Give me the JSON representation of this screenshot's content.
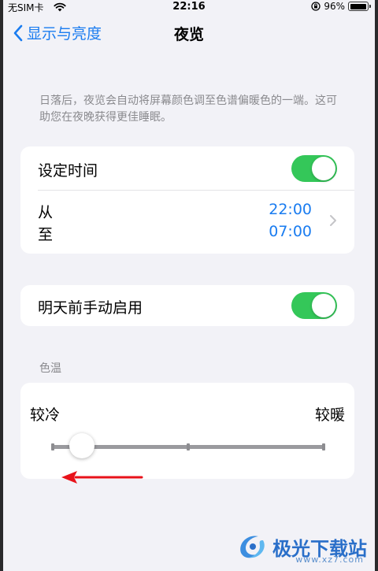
{
  "status_bar": {
    "carrier": "无SIM卡",
    "time": "22:16",
    "battery": "96%",
    "battery_level": 0.96,
    "icons": [
      "wifi-icon",
      "rotation-lock-icon",
      "battery-icon"
    ]
  },
  "nav": {
    "back_label": "显示与亮度",
    "title": "夜览"
  },
  "description": "日落后，夜览会自动将屏幕颜色调至色谱偏暖色的一端。这可助您在夜晚获得更佳睡眠。",
  "schedule": {
    "label": "设定时间",
    "enabled": true,
    "from_label": "从",
    "to_label": "至",
    "from_time": "22:00",
    "to_time": "07:00"
  },
  "manual": {
    "label": "明天前手动启用",
    "enabled": true
  },
  "temperature": {
    "header": "色温",
    "cooler_label": "较冷",
    "warmer_label": "较暖",
    "value": 0.11
  },
  "watermark": {
    "text": "极光下载站",
    "url": "www.xz7.com"
  },
  "colors": {
    "accent": "#1a7cf0",
    "toggle_on": "#34c759",
    "annotation_arrow": "#e8121a"
  }
}
